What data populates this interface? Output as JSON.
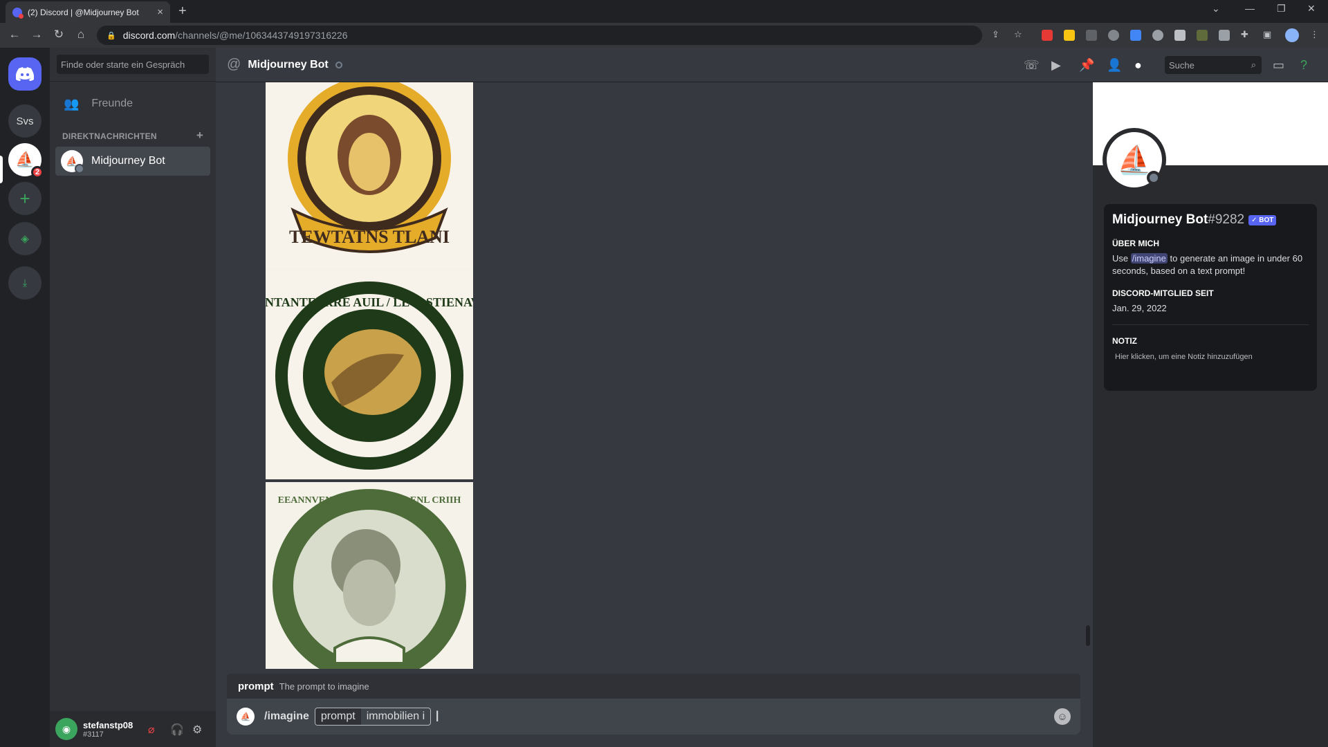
{
  "browser": {
    "tab_title": "(2) Discord | @Midjourney Bot",
    "url_host": "discord.com",
    "url_path": "/channels/@me/1063443749197316226"
  },
  "guilds": {
    "svs_label": "Svs",
    "mention_count": "2"
  },
  "dm_sidebar": {
    "search_placeholder": "Finde oder starte ein Gespräch",
    "friends_label": "Freunde",
    "section_header": "DIREKTNACHRICHTEN",
    "dm_items": [
      {
        "name": "Midjourney Bot"
      }
    ]
  },
  "user_panel": {
    "username": "stefanstp08",
    "discriminator": "#3117"
  },
  "topbar": {
    "channel_name": "Midjourney Bot",
    "search_placeholder": "Suche"
  },
  "messages": {
    "images": [
      {
        "caption": "TEWTATNS TLANI",
        "colors": [
          "#3f2a1e",
          "#e5ac2a",
          "#f7f3eb"
        ]
      },
      {
        "caption": "LATNTANTEERRE AUIL / LEVASTIENAVIIV",
        "colors": [
          "#1e3a18",
          "#c9a14a",
          "#f7f3eb"
        ]
      },
      {
        "caption": "EEANNVENT EAEAGR / TRAENL CRIIH",
        "colors": [
          "#4e6b3a",
          "#d9ddcc",
          "#f5f2ea"
        ]
      }
    ]
  },
  "composer": {
    "hint_key": "prompt",
    "hint_desc": "The prompt to imagine",
    "command": "/imagine",
    "option_name": "prompt",
    "option_value": "immobilien i"
  },
  "profile": {
    "name": "Midjourney Bot",
    "tag": "#9282",
    "badge": "✓ BOT",
    "about_header": "ÜBER MICH",
    "about_pre": "Use",
    "about_cmd": "/imagine",
    "about_post": "to generate an image in under 60 seconds, based on a text prompt!",
    "member_header": "DISCORD-MITGLIED SEIT",
    "member_since": "Jan. 29, 2022",
    "note_header": "NOTIZ",
    "note_placeholder": "Hier klicken, um eine Notiz hinzuzufügen"
  },
  "theme": {
    "accent": "#5865f2",
    "green": "#3ba55d",
    "danger": "#ed4245"
  }
}
